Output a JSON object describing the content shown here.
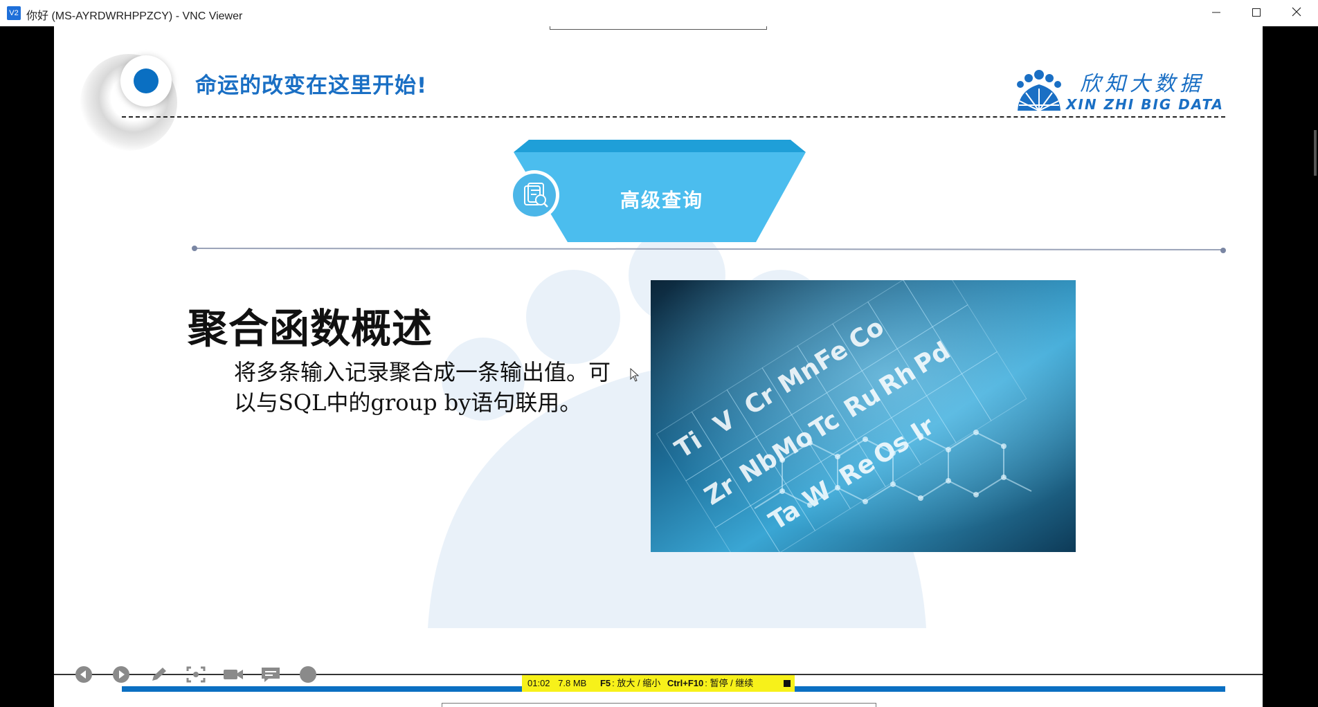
{
  "window": {
    "app_icon": "V2",
    "title": "你好 (MS-AYRDWRHPPZCY) - VNC Viewer",
    "minimize_icon": "minimize-icon",
    "maximize_icon": "maximize-icon",
    "close_icon": "close-icon"
  },
  "slide": {
    "slogan": "命运的改变在这里开始!",
    "logo": {
      "cn": "欣知大数据",
      "en": "XIN ZHI BIG DATA"
    },
    "section_title": "高级查询",
    "heading": "聚合函数概述",
    "body": "将多条输入记录聚合成一条输出值。可以与SQL中的group by语句联用。",
    "colors": {
      "accent": "#1a6fc4",
      "banner": "#4bbdee",
      "banner_dark": "#1f9fd8"
    }
  },
  "player": {
    "tools": [
      "prev-icon",
      "next-icon",
      "pen-icon",
      "screenshot-icon",
      "camera-icon",
      "comment-icon",
      "more-icon"
    ],
    "status": {
      "time": "01:02",
      "size": "7.8 MB",
      "key1": "F5",
      "key1_desc": ": 放大 / 缩小",
      "key2": "Ctrl+F10",
      "key2_desc": ": 暂停 / 继续"
    }
  }
}
